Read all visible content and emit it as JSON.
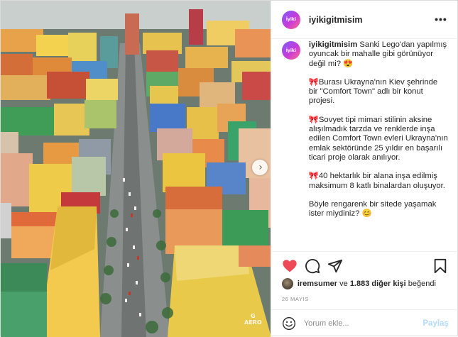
{
  "post": {
    "username": "iyikigitmisim",
    "avatar_text": "İyiki",
    "caption_username": "iyikigitmisim",
    "caption_paragraphs": [
      "Sanki Lego'dan yapılmış oyuncak bir mahalle gibi görünüyor değil mi? 😍",
      "🎀Burası Ukrayna'nın Kiev şehrinde bir \"Comfort Town\" adlı bir konut projesi.",
      "🎀Sovyet tipi mimari stilinin aksine alışılmadık tarzda ve renklerde inşa edilen Comfort Town evleri Ukrayna'nın emlak sektöründe 25 yıldır en başarılı ticari proje olarak anılıyor.",
      "🎀40 hektarlık bir alana inşa edilmiş maksimum 8 katlı binalardan oluşuyor.",
      "Böyle rengarenk bir sitede yaşamak ister miydiniz? 😊"
    ],
    "more_label": "•••",
    "likes": {
      "first_user": "iremsumer",
      "connector": " ve ",
      "others": "1.883 diğer kişi",
      "suffix": " beğendi"
    },
    "date": "26 MAYIS",
    "comment_placeholder": "Yorum ekle...",
    "share_label": "Paylaş",
    "next_icon": "chevron-right-icon",
    "watermark": "G\nAERO"
  },
  "colors": {
    "like_red": "#ed4956",
    "link_disabled": "#b3dbff",
    "muted": "#8e8e8e"
  },
  "icons": [
    "heart-icon",
    "comment-icon",
    "share-icon",
    "bookmark-icon",
    "smiley-icon"
  ]
}
